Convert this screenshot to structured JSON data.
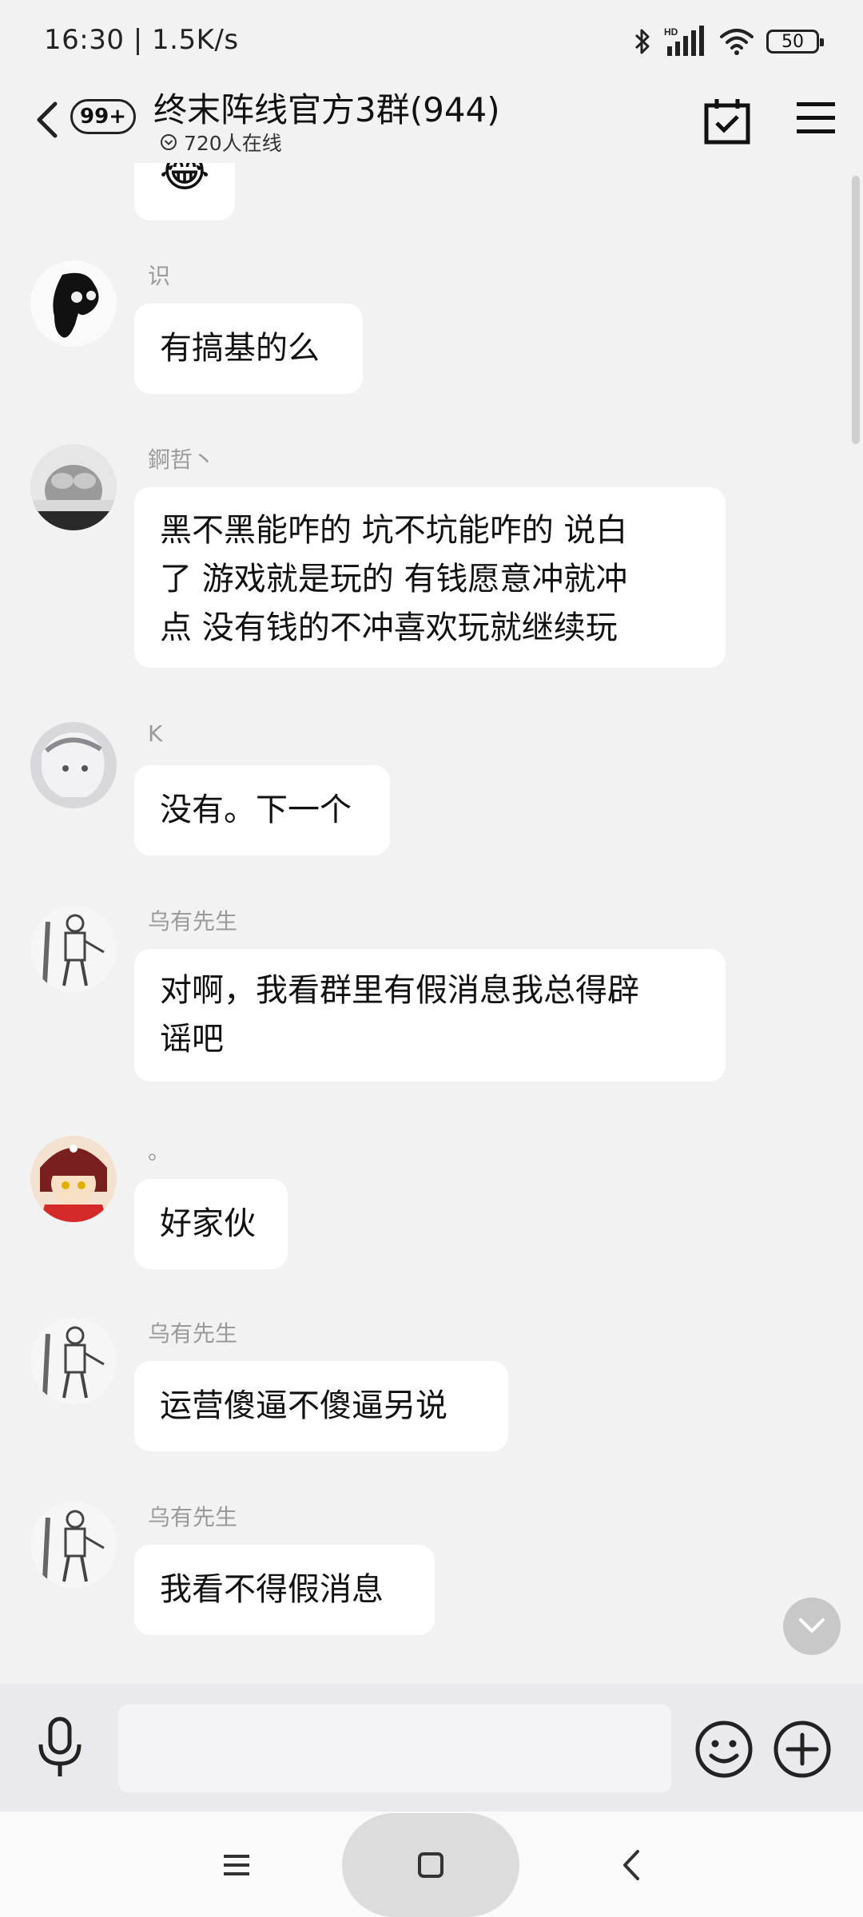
{
  "status_bar": {
    "time_speed": "16:30 | 1.5K/s",
    "hd_label": "HD",
    "battery": "50",
    "icons": [
      "bluetooth-icon",
      "signal-icon",
      "wifi-icon",
      "battery-icon"
    ]
  },
  "header": {
    "unread_badge": "99+",
    "title": "终末阵线官方3群(944)",
    "online_text": "720人在线",
    "icons": [
      "back-arrow-icon",
      "calendar-check-icon",
      "menu-icon",
      "chevron-circle-icon"
    ]
  },
  "messages": [
    {
      "sender": "识",
      "text": "有搞基的么"
    },
    {
      "sender": "錒哲丶",
      "lines": [
        "黑不黑能咋的 坑不坑能咋的 说白",
        "了 游戏就是玩的 有钱愿意冲就冲",
        "点  没有钱的不冲喜欢玩就继续玩"
      ]
    },
    {
      "sender": "K",
      "text": "没有。下一个"
    },
    {
      "sender": "乌有先生",
      "lines": [
        "对啊，我看群里有假消息我总得辟",
        "谣吧"
      ]
    },
    {
      "sender": "。",
      "text": "好家伙"
    },
    {
      "sender": "乌有先生",
      "text": "运营傻逼不傻逼另说"
    },
    {
      "sender": "乌有先生",
      "text": "我看不得假消息"
    }
  ],
  "top_partial_emoji": "😂",
  "input_bar": {
    "placeholder": "",
    "icons": [
      "microphone-icon",
      "emoji-icon",
      "plus-icon"
    ]
  },
  "nav_bar": {
    "icons": [
      "recents-icon",
      "home-icon",
      "back-icon"
    ]
  },
  "colors": {
    "background": "#f2f2f2",
    "bubble": "#ffffff",
    "sender_name": "#9a9a9a",
    "input_bar": "#e9e9ee"
  }
}
